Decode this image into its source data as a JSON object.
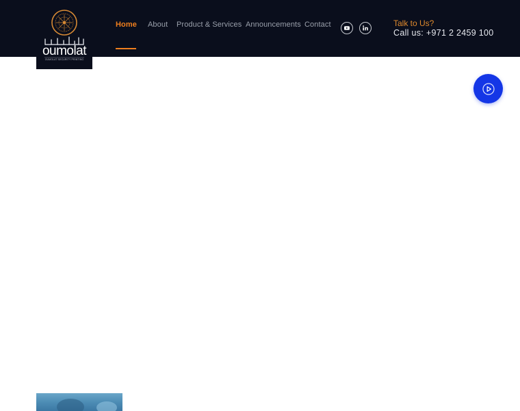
{
  "brand": {
    "name": "oumolat",
    "tagline": "OUMOLAT SECURITY PRINTING"
  },
  "nav": {
    "items": [
      {
        "label": "Home",
        "active": true
      },
      {
        "label": "About",
        "active": false
      },
      {
        "label": "Product & Services",
        "active": false
      },
      {
        "label": "Announcements",
        "active": false
      },
      {
        "label": "Contact",
        "active": false
      }
    ]
  },
  "social": {
    "youtube": "youtube-icon",
    "linkedin": "linkedin-icon"
  },
  "contact": {
    "talk_label": "Talk to Us?",
    "call_text": "Call us: +971 2 2459 100"
  },
  "media": {
    "play_icon": "play-icon"
  },
  "colors": {
    "header_bg": "#0a0e1c",
    "accent_orange": "#f07f1e",
    "play_blue": "#1436e6"
  }
}
